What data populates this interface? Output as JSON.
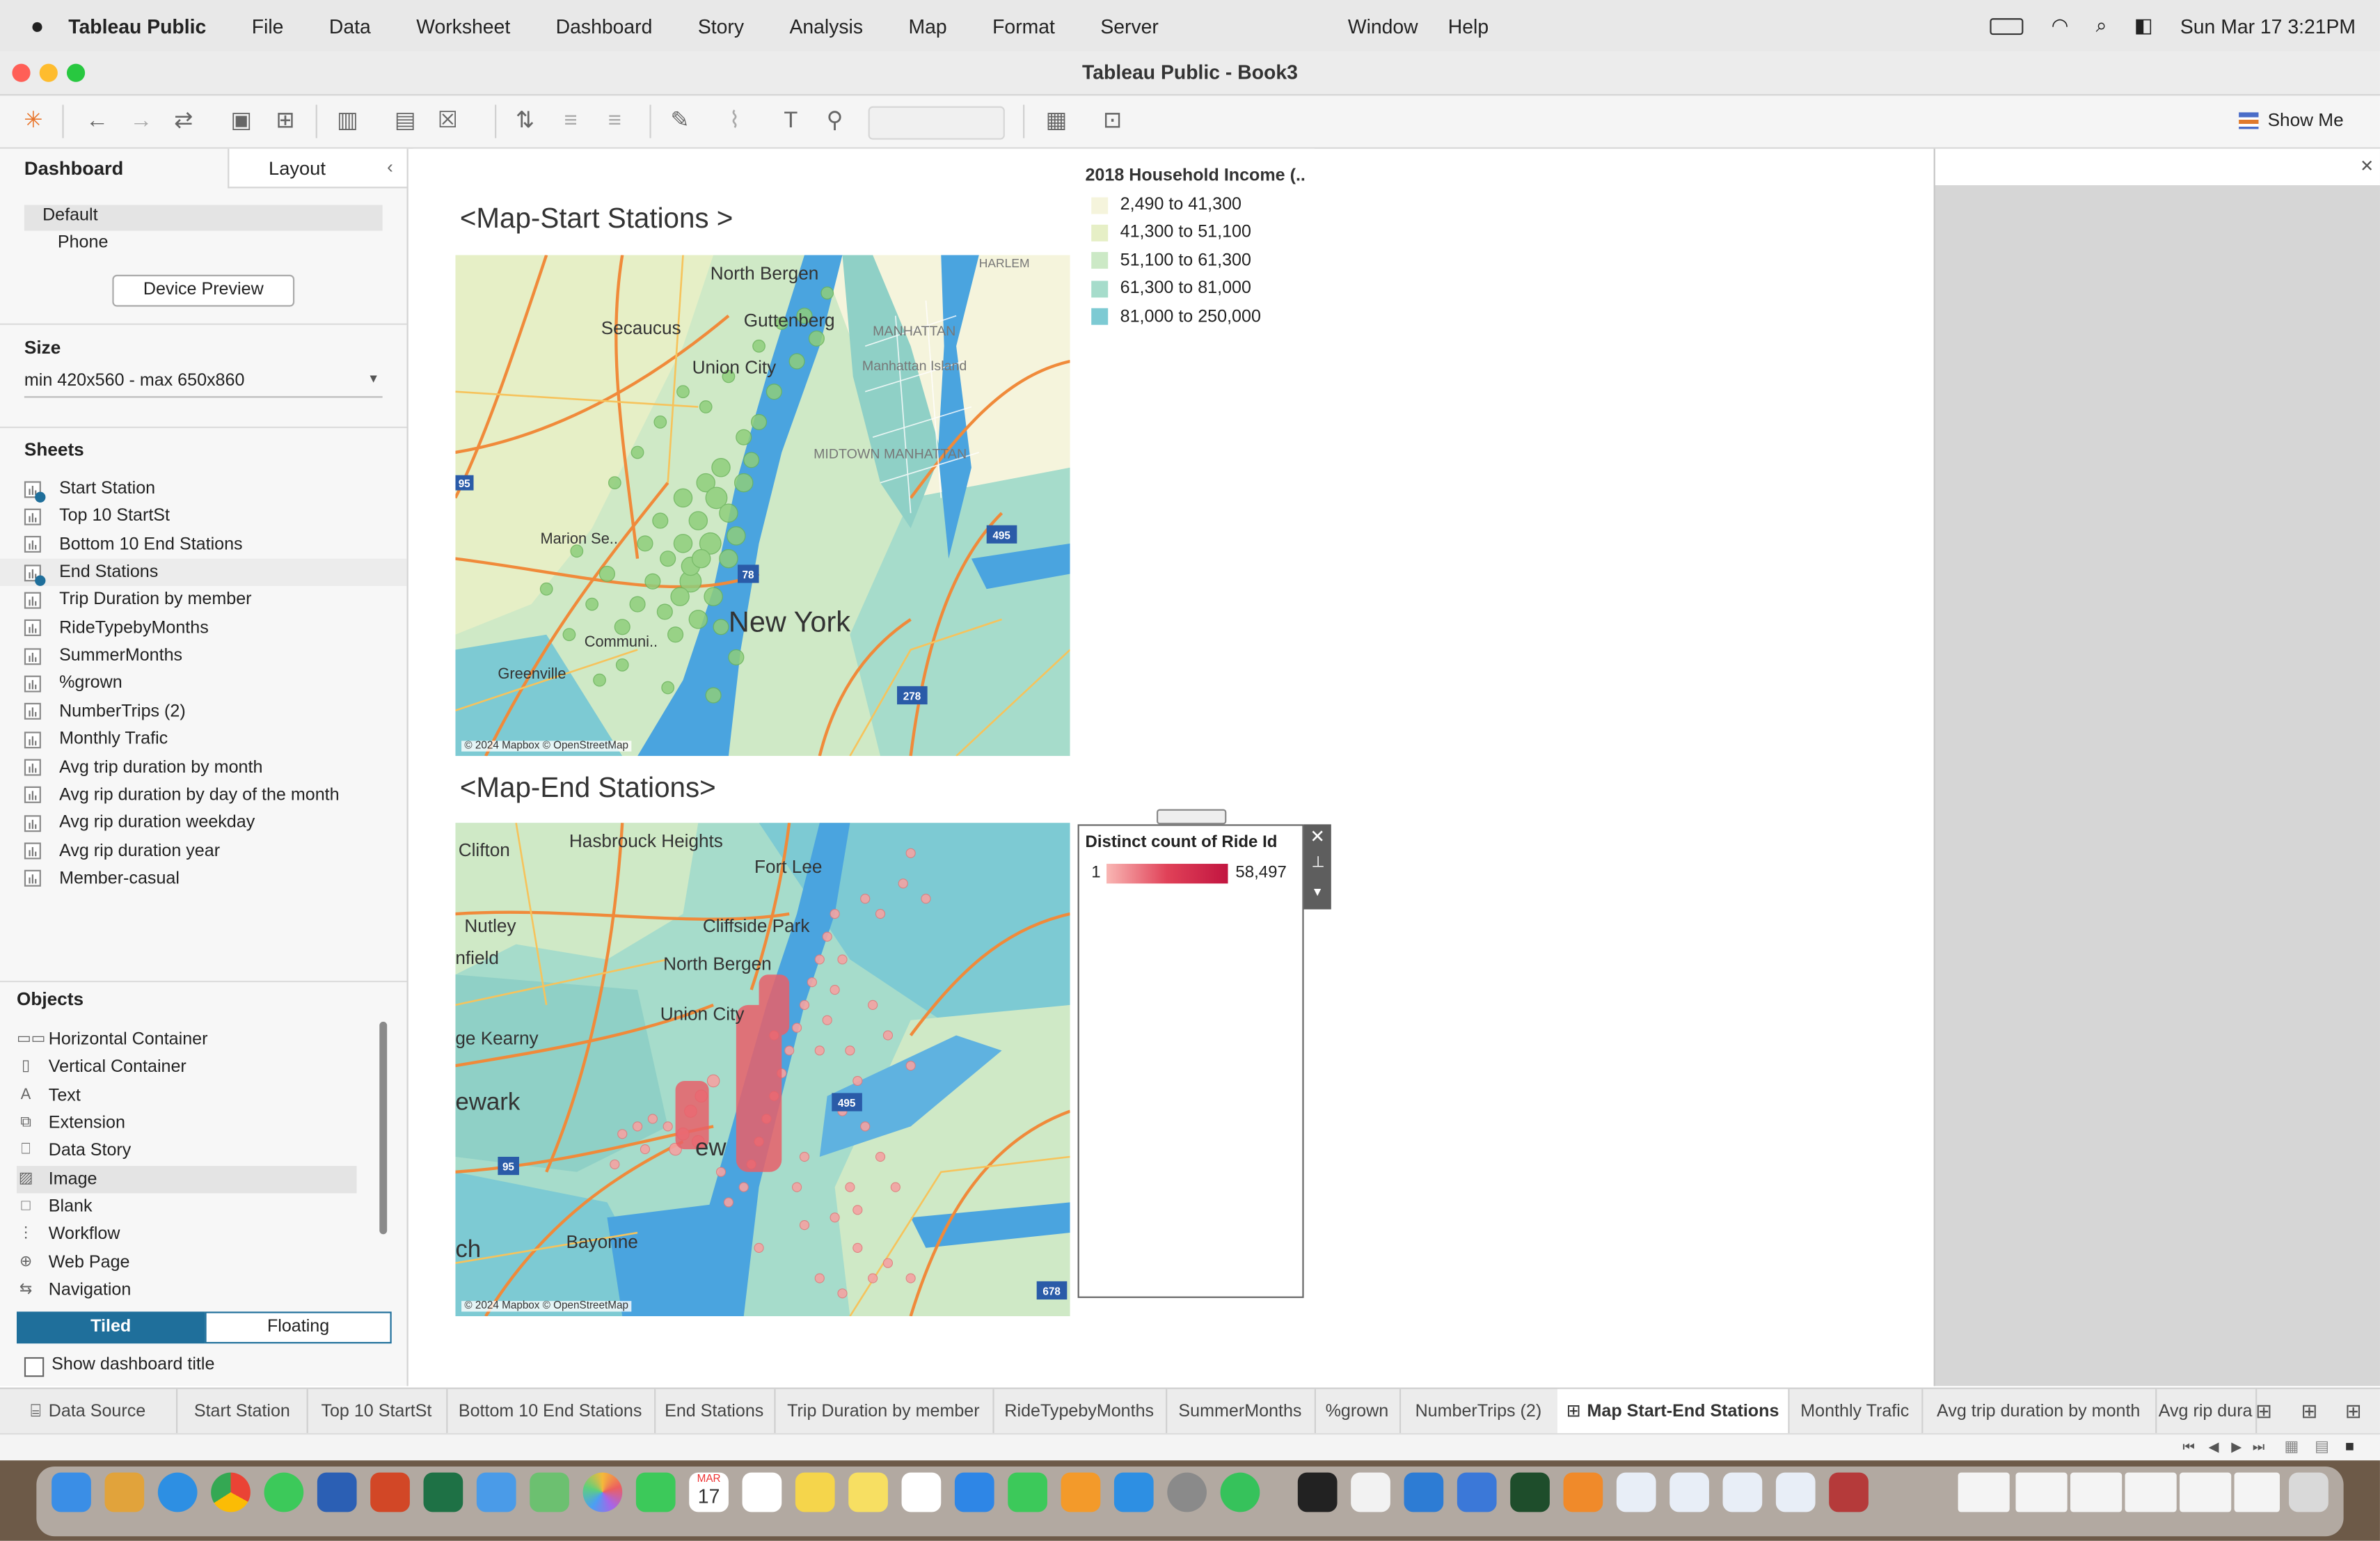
{
  "menubar": {
    "app": "Tableau Public",
    "items": [
      "File",
      "Data",
      "Worksheet",
      "Dashboard",
      "Story",
      "Analysis",
      "Map",
      "Format",
      "Server"
    ],
    "items_right": [
      "Window",
      "Help"
    ],
    "clock": "Sun Mar 17  3:21PM"
  },
  "window": {
    "title": "Tableau Public - Book3"
  },
  "toolbar": {
    "show_me": "Show Me"
  },
  "left": {
    "tab_dashboard": "Dashboard",
    "tab_layout": "Layout",
    "devices": [
      "Default",
      "Phone"
    ],
    "device_preview": "Device Preview",
    "size_header": "Size",
    "size_value": "min 420x560 - max 650x860",
    "sheets_header": "Sheets",
    "sheets": [
      "Start Station",
      "Top 10 StartSt",
      "Bottom 10 End Stations",
      "End Stations",
      "Trip Duration by member",
      "RideTypebyMonths",
      "SummerMonths",
      "%grown",
      "NumberTrips (2)",
      "Monthly Trafic",
      "Avg trip duration by month",
      "Avg rip duration by day of the month",
      "Avg rip duration weekday",
      "Avg rip duration year",
      "Member-casual"
    ],
    "objects_header": "Objects",
    "objects": [
      "Horizontal Container",
      "Vertical Container",
      "Text",
      "Extension",
      "Data Story",
      "Image",
      "Blank",
      "Workflow",
      "Web Page",
      "Navigation"
    ],
    "tiled": "Tiled",
    "floating": "Floating",
    "show_title": "Show dashboard title"
  },
  "dashboard": {
    "map1_title": "<Map-Start Stations >",
    "map2_title": "<Map-End Stations>",
    "attribution": "© 2024 Mapbox © OpenStreetMap",
    "income_legend": {
      "title": "2018 Household Income (..",
      "items": [
        {
          "label": "2,490 to 41,300",
          "color": "#f5f4dc"
        },
        {
          "label": "41,300 to 51,100",
          "color": "#e6efc6"
        },
        {
          "label": "51,100 to 61,300",
          "color": "#cce9c6"
        },
        {
          "label": "61,300 to 81,000",
          "color": "#a6dccb"
        },
        {
          "label": "81,000 to 250,000",
          "color": "#7dcad3"
        }
      ]
    },
    "ride_legend": {
      "title": "Distinct count of Ride Id",
      "min": "1",
      "max": "58,497"
    },
    "map1_labels": [
      "North Bergen",
      "Secaucus",
      "Guttenberg",
      "MANHATTAN",
      "HARLEM",
      "Union City",
      "Manhattan Island",
      "MIDTOWN MANHATTAN",
      "Marion Se..",
      "New York",
      "Communi..",
      "Greenville"
    ],
    "map2_labels": [
      "Clifton",
      "Hasbrouck Heights",
      "Fort Lee",
      "Nutley",
      "nfield",
      "Cliffside Park",
      "North Bergen",
      "Union City",
      "ge Kearny",
      "ewark",
      "Bayonne",
      "ch",
      "ew"
    ],
    "highway_labels": [
      "95",
      "495",
      "78",
      "278",
      "95",
      "495",
      "678"
    ]
  },
  "tabs": {
    "data_source": "Data Source",
    "items": [
      "Start Station",
      "Top 10 StartSt",
      "Bottom 10 End Stations",
      "End Stations",
      "Trip Duration by member",
      "RideTypebyMonths",
      "SummerMonths",
      "%grown",
      "NumberTrips (2)"
    ],
    "active": "Map Start-End Stations",
    "after": [
      "Monthly Trafic",
      "Avg trip duration by month",
      "Avg rip dura"
    ]
  },
  "dock": {
    "calendar_month": "MAR",
    "calendar_day": "17"
  }
}
